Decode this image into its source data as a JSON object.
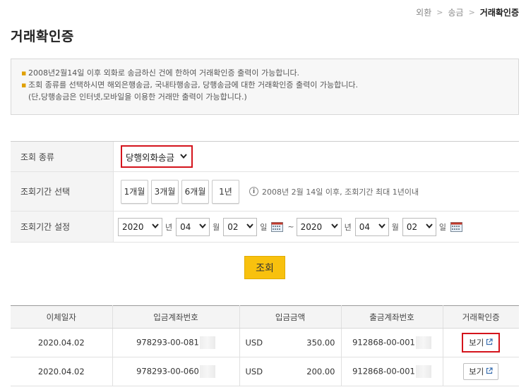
{
  "breadcrumb": [
    "외환",
    "송금",
    "거래확인증"
  ],
  "page_title": "거래확인증",
  "notice": {
    "line1": "2008년2월14일 이후 외화로 송금하신 건에 한하여 거래확인증 출력이 가능합니다.",
    "line2": "조회 종류를 선택하시면 해외은행송금, 국내타행송금, 당행송금에 대한 거래확인증 출력이 가능합니다.",
    "line2_sub": "(단,당행송금은 인터넷,모바일을 이용한 거래만 출력이 가능합니다.)"
  },
  "form": {
    "type_label": "조회 종류",
    "type_value": "당행외화송금",
    "period_label": "조회기간 선택",
    "period_buttons": [
      "1개월",
      "3개월",
      "6개월",
      "1년"
    ],
    "period_note": "2008년 2월 14일 이후, 조회기간 최대 1년이내",
    "range_label": "조회기간 설정",
    "start": {
      "year": "2020",
      "month": "04",
      "day": "02"
    },
    "end": {
      "year": "2020",
      "month": "04",
      "day": "02"
    },
    "unit_year": "년",
    "unit_month": "월",
    "unit_day": "일",
    "tilde": "~"
  },
  "search_label": "조회",
  "table": {
    "headers": [
      "이체일자",
      "입금계좌번호",
      "입금금액",
      "출금계좌번호",
      "거래확인증"
    ],
    "rows": [
      {
        "date": "2020.04.02",
        "in_account": "978293-00-081",
        "currency": "USD",
        "amount": "350.00",
        "out_account": "912868-00-001",
        "action": "보기"
      },
      {
        "date": "2020.04.02",
        "in_account": "978293-00-060",
        "currency": "USD",
        "amount": "200.00",
        "out_account": "912868-00-001",
        "action": "보기"
      }
    ]
  },
  "colors": {
    "accent_red": "#d4141c",
    "search_yellow": "#f8c10e",
    "notice_dot": "#e0a000"
  },
  "icons": [
    "chevron-right-icon",
    "info-icon",
    "calendar-icon",
    "external-link-icon",
    "select-arrow-icon"
  ]
}
